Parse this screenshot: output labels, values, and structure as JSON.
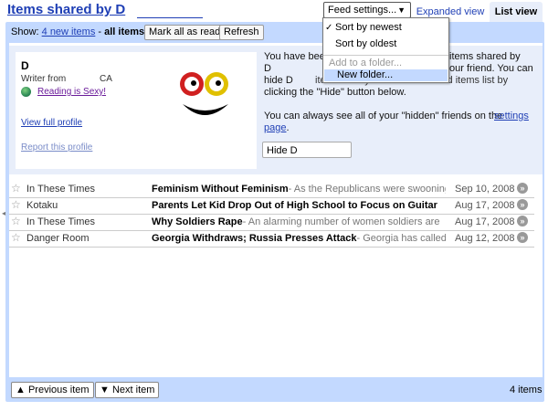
{
  "header": {
    "title": "Items shared by D",
    "feed_settings_label": "Feed settings...",
    "tab_expanded": "Expanded view",
    "tab_list": "List view"
  },
  "toolbar": {
    "show_label": "Show:",
    "new_items_link": "4 new items",
    "separator": " - ",
    "all_items": "all items",
    "mark_all_read": "Mark all as read",
    "refresh": "Refresh"
  },
  "dropdown": {
    "sort_newest": "Sort by newest",
    "sort_oldest": "Sort by oldest",
    "add_to_folder": "Add to a folder...",
    "new_folder": "New folder..."
  },
  "profile": {
    "name": "D",
    "writer_from": "Writer from",
    "location": "CA",
    "blog_link": "Reading is Sexy!",
    "view_full_profile": "View full profile",
    "report_profile": "Report this profile"
  },
  "info": {
    "line1a": "You have been",
    "line1b": "items shared by",
    "line2a": "D",
    "line2b": "our friend. You can",
    "line3a": "hide D",
    "line3b": "items from your friends' shared items list by",
    "line4": "clicking the \"Hide\" button below.",
    "line5": "You can always see all of your \"hidden\" friends on the",
    "settings_link_a": "settings",
    "settings_link_b": "page",
    "period": ".",
    "hide_button": "Hide D"
  },
  "items": [
    {
      "source": "In These Times",
      "title": "Feminism Without Feminism",
      "snippet": "- As the Republicans were swooning",
      "date": "Sep 10, 2008"
    },
    {
      "source": "Kotaku",
      "title": "Parents Let Kid Drop Out of High School to Focus on Guitar",
      "snippet": "",
      "date": "Aug 17, 2008"
    },
    {
      "source": "In These Times",
      "title": "Why Soldiers Rape",
      "snippet": "- An alarming number of women soldiers are",
      "date": "Aug 17, 2008"
    },
    {
      "source": "Danger Room",
      "title": "Georgia Withdraws; Russia Presses Attack",
      "snippet": "- Georgia has called",
      "date": "Aug 12, 2008"
    }
  ],
  "footer": {
    "previous_item": "Previous item",
    "next_item": "Next item",
    "item_count": "4 items"
  },
  "colors": {
    "accent": "#c3d9ff",
    "link": "#1f3fb5"
  }
}
